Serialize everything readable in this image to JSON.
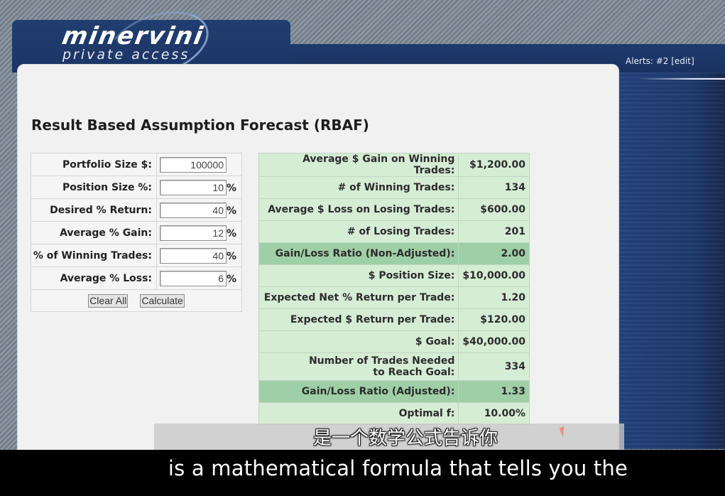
{
  "header": {
    "logo_brand": "minervini",
    "logo_sub": "private access",
    "alerts_label": "Alerts:",
    "alerts_count": "#2",
    "alerts_edit": "[edit]"
  },
  "page": {
    "title": "Result Based Assumption Forecast (RBAF)"
  },
  "inputs": [
    {
      "label": "Portfolio Size $:",
      "value": "100000",
      "unit": ""
    },
    {
      "label": "Position Size %:",
      "value": "10",
      "unit": "%"
    },
    {
      "label": "Desired % Return:",
      "value": "40",
      "unit": "%"
    },
    {
      "label": "Average % Gain:",
      "value": "12",
      "unit": "%"
    },
    {
      "label": "% of Winning Trades:",
      "value": "40",
      "unit": "%"
    },
    {
      "label": "Average % Loss:",
      "value": "6",
      "unit": "%"
    }
  ],
  "buttons": {
    "clear": "Clear All",
    "calculate": "Calculate"
  },
  "results": [
    {
      "label": "Average $ Gain on Winning Trades:",
      "value": "$1,200.00",
      "highlight": false
    },
    {
      "label": "# of Winning Trades:",
      "value": "134",
      "highlight": false
    },
    {
      "label": "Average $ Loss on Losing Trades:",
      "value": "$600.00",
      "highlight": false
    },
    {
      "label": "# of Losing Trades:",
      "value": "201",
      "highlight": false
    },
    {
      "label": "Gain/Loss Ratio (Non-Adjusted):",
      "value": "2.00",
      "highlight": true
    },
    {
      "label": "$ Position Size:",
      "value": "$10,000.00",
      "highlight": false
    },
    {
      "label": "Expected Net % Return per Trade:",
      "value": "1.20",
      "highlight": false
    },
    {
      "label": "Expected $ Return per Trade:",
      "value": "$120.00",
      "highlight": false
    },
    {
      "label": "$ Goal:",
      "value": "$40,000.00",
      "highlight": false
    },
    {
      "label": "Number of Trades Needed to Reach Goal:",
      "value": "334",
      "highlight": false
    },
    {
      "label": "Gain/Loss Ratio (Adjusted):",
      "value": "1.33",
      "highlight": true
    },
    {
      "label": "Optimal f:",
      "value": "10.00%",
      "highlight": false
    }
  ],
  "subtitles": {
    "chinese": "是一个数学公式告诉你",
    "english": "is a mathematical formula that tells you the"
  },
  "colors": {
    "brand_navy": "#1f3a6c",
    "result_cell": "#d5ecd5",
    "result_highlight": "#9fcfa6"
  }
}
